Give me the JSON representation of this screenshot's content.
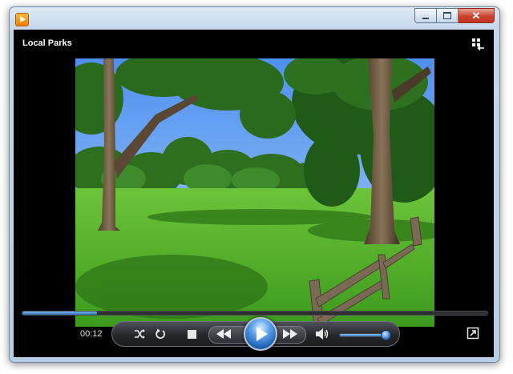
{
  "window": {
    "title": "Local Parks",
    "controls": {
      "minimize_icon": "minimize-icon",
      "maximize_icon": "maximize-icon",
      "close_icon": "close-icon",
      "close_glyph": "✕"
    }
  },
  "player": {
    "elapsed": "00:12",
    "seek_progress": 0.16,
    "volume_level": 0.95,
    "accent_color": "#3d86d9",
    "icons": [
      "switch-to-library-icon",
      "shuffle-icon",
      "repeat-icon",
      "stop-icon",
      "previous-icon",
      "play-icon",
      "next-icon",
      "mute-icon",
      "fullscreen-icon"
    ]
  }
}
